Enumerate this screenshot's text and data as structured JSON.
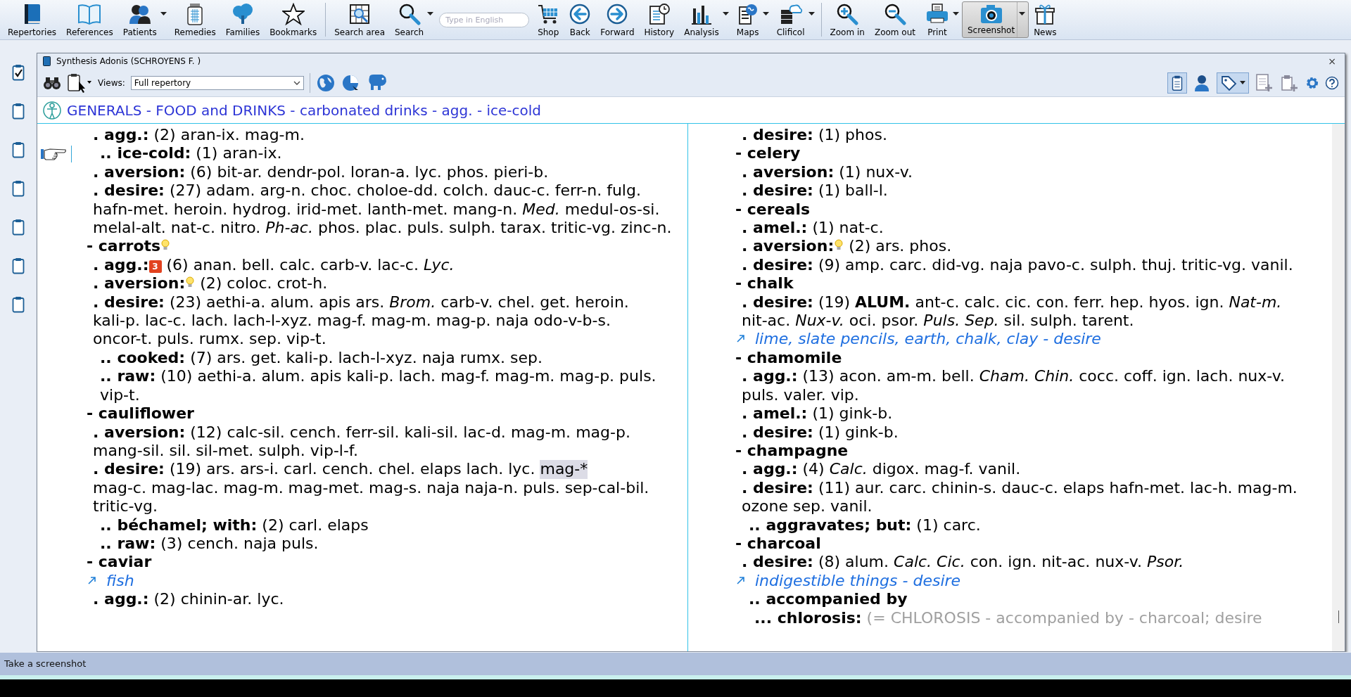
{
  "toolbar": {
    "groups": [
      [
        {
          "label": "Repertories",
          "dropdown": false,
          "selected": false
        },
        {
          "label": "References",
          "dropdown": false,
          "selected": false
        },
        {
          "label": "Patients",
          "dropdown": true,
          "selected": false
        },
        {
          "label": "Remedies",
          "dropdown": false,
          "selected": false
        },
        {
          "label": "Families",
          "dropdown": false,
          "selected": false
        },
        {
          "label": "Bookmarks",
          "dropdown": false,
          "selected": false
        }
      ],
      [
        {
          "label": "Search area",
          "dropdown": false,
          "selected": false
        },
        {
          "label": "Search",
          "dropdown": true,
          "selected": false
        },
        {
          "kind": "field",
          "placeholder": "Type in English"
        },
        {
          "label": "Shop",
          "dropdown": false,
          "selected": false
        },
        {
          "label": "Back",
          "dropdown": false,
          "selected": false
        },
        {
          "label": "Forward",
          "dropdown": false,
          "selected": false
        },
        {
          "label": "History",
          "dropdown": false,
          "selected": false
        },
        {
          "label": "Analysis",
          "dropdown": true,
          "selected": false
        },
        {
          "label": "Maps",
          "dropdown": true,
          "selected": false
        },
        {
          "label": "Clificol",
          "dropdown": true,
          "selected": false
        }
      ],
      [
        {
          "label": "Zoom in",
          "dropdown": false,
          "selected": false
        },
        {
          "label": "Zoom out",
          "dropdown": false,
          "selected": false
        },
        {
          "label": "Print",
          "dropdown": true,
          "selected": false
        },
        {
          "label": "Screenshot",
          "dropdown": true,
          "selected": true
        },
        {
          "label": "News",
          "dropdown": false,
          "selected": false
        }
      ]
    ]
  },
  "clipboards": [
    {
      "checked": true
    },
    {
      "checked": false
    },
    {
      "checked": false
    },
    {
      "checked": false
    },
    {
      "checked": false
    },
    {
      "checked": false
    },
    {
      "checked": false
    }
  ],
  "window": {
    "title": "Synthesis Adonis (SCHROYENS F. )",
    "close": "×",
    "views_label": "Views:",
    "views_value": "Full repertory",
    "breadcrumb": "GENERALS - FOOD and DRINKS - carbonated drinks - agg. - ice-cold"
  },
  "columns": [
    {
      "lines": [
        {
          "kind": "sub",
          "label": ". agg.:",
          "count": "(2)",
          "remedies": "aran-ix. mag-m.",
          "current": false
        },
        {
          "kind": "subsub",
          "label": ".. ice-cold:",
          "count": "(1)",
          "remedies": "aran-ix.",
          "current": true
        },
        {
          "kind": "sub",
          "label": ". aversion:",
          "count": "(6)",
          "remedies": "bit-ar. dendr-pol. loran-a. lyc. phos. pieri-b.",
          "current": false
        },
        {
          "kind": "sub",
          "label": ". desire:",
          "count": "(27)",
          "remedies": "adam. arg-n. choc. choloe-dd. colch. dauc-c. ferr-n. fulg. hafn-met. heroin. hydrog. irid-met. lanth-met. mang-n. *Med.* medul-os-si. melal-alt. nat-c. nitro. *Ph-ac.* phos. plac. puls. sulph. tarax. tritic-vg. zinc-n.",
          "current": false
        },
        {
          "kind": "rubric",
          "label": "- carrots",
          "marker": {
            "kind": "bulb"
          },
          "current": false
        },
        {
          "kind": "sub",
          "label": ". agg.:",
          "marker": {
            "kind": "number",
            "text": "3"
          },
          "count": "(6)",
          "remedies": "anan. bell. calc. carb-v. lac-c. *Lyc.*",
          "current": false
        },
        {
          "kind": "sub",
          "label": ". aversion:",
          "marker": {
            "kind": "bulb"
          },
          "count": "(2)",
          "remedies": "coloc. crot-h.",
          "current": false
        },
        {
          "kind": "sub",
          "label": ". desire:",
          "count": "(23)",
          "remedies": "aethi-a. alum. apis ars. *Brom.* carb-v. chel. get. heroin. kali-p. lac-c. lach. lach-l-xyz. mag-f. mag-m. mag-p. naja odo-v-b-s. oncor-t. puls. rumx. sep. vip-t.",
          "current": false
        },
        {
          "kind": "subsub",
          "label": ".. cooked:",
          "count": "(7)",
          "remedies": "ars. get. kali-p. lach-l-xyz. naja rumx. sep.",
          "current": false
        },
        {
          "kind": "subsub",
          "label": ".. raw:",
          "count": "(10)",
          "remedies": "aethi-a. alum. apis kali-p. lach. mag-f. mag-m. mag-p. puls. vip-t.",
          "current": false
        },
        {
          "kind": "rubric",
          "label": "- cauliflower",
          "current": false
        },
        {
          "kind": "sub",
          "label": ". aversion:",
          "count": "(12)",
          "remedies": "calc-sil. cench. ferr-sil. kali-sil. lac-d. mag-m. mag-p. mang-sil. sil. sil-met. sulph. vip-l-f.",
          "current": false
        },
        {
          "kind": "sub",
          "label": ". desire:",
          "count": "(19)",
          "remedies": [
            {
              "text": "ars. ars-i. carl. cench. chel. elaps lach. lyc.",
              "marked": false
            },
            {
              "text": "mag-*",
              "marked": true
            },
            {
              "text": "mag-c. mag-lac. mag-m. mag-met. mag-s. naja naja-n. puls. sep-cal-bil. tritic-vg.",
              "marked": false
            }
          ],
          "current": false
        },
        {
          "kind": "subsub",
          "label": ".. béchamel; with:",
          "count": "(2)",
          "remedies": "carl. elaps",
          "current": false
        },
        {
          "kind": "subsub",
          "label": ".. raw:",
          "count": "(3)",
          "remedies": "cench. naja puls.",
          "current": false
        },
        {
          "kind": "rubric",
          "label": "- caviar",
          "current": false
        },
        {
          "kind": "ref",
          "label": "fish",
          "current": false
        },
        {
          "kind": "sub",
          "label": ". agg.:",
          "count": "(2)",
          "remedies": "chinin-ar. lyc.",
          "current": false
        }
      ]
    },
    {
      "lines": [
        {
          "kind": "sub",
          "label": ". desire:",
          "count": "(1)",
          "remedies": "phos.",
          "current": false
        },
        {
          "kind": "rubric",
          "label": "- celery",
          "current": false
        },
        {
          "kind": "sub",
          "label": ". aversion:",
          "count": "(1)",
          "remedies": "nux-v.",
          "current": false
        },
        {
          "kind": "sub",
          "label": ". desire:",
          "count": "(1)",
          "remedies": "ball-l.",
          "current": false
        },
        {
          "kind": "rubric",
          "label": "- cereals",
          "current": false
        },
        {
          "kind": "sub",
          "label": ". amel.:",
          "count": "(1)",
          "remedies": "nat-c.",
          "current": false
        },
        {
          "kind": "sub",
          "label": ". aversion:",
          "marker": {
            "kind": "bulb"
          },
          "count": "(2)",
          "remedies": "ars. phos.",
          "current": false
        },
        {
          "kind": "sub",
          "label": ". desire:",
          "count": "(9)",
          "remedies": "amp. carc. did-vg. naja pavo-c. sulph. thuj. tritic-vg. vanil.",
          "current": false
        },
        {
          "kind": "rubric",
          "label": "- chalk",
          "current": false
        },
        {
          "kind": "sub",
          "label": ". desire:",
          "count": "(19)",
          "remedies": "**ALUM.** ant-c. calc. cic. con. ferr. hep. hyos. ign. *Nat-m.* nit-ac. *Nux-v.* oci. psor. *Puls.* *Sep.* sil. sulph. tarent.",
          "current": false
        },
        {
          "kind": "ref",
          "label": "lime, slate pencils, earth, chalk, clay - desire",
          "current": false
        },
        {
          "kind": "rubric",
          "label": "- chamomile",
          "current": false
        },
        {
          "kind": "sub",
          "label": ". agg.:",
          "count": "(13)",
          "remedies": "acon. am-m. bell. *Cham.* *Chin.* cocc. coff. ign. lach. nux-v. puls. valer. vip.",
          "current": false
        },
        {
          "kind": "sub",
          "label": ". amel.:",
          "count": "(1)",
          "remedies": "gink-b.",
          "current": false
        },
        {
          "kind": "sub",
          "label": ". desire:",
          "count": "(1)",
          "remedies": "gink-b.",
          "current": false
        },
        {
          "kind": "rubric",
          "label": "- champagne",
          "current": false
        },
        {
          "kind": "sub",
          "label": ". agg.:",
          "count": "(4)",
          "remedies": "*Calc.* digox. mag-f. vanil.",
          "current": false
        },
        {
          "kind": "sub",
          "label": ". desire:",
          "count": "(11)",
          "remedies": "aur. carc. chinin-s. dauc-c. elaps hafn-met. lac-h. mag-m. ozone sep. vanil.",
          "current": false
        },
        {
          "kind": "subsub",
          "label": ".. aggravates; but:",
          "count": "(1)",
          "remedies": "carc.",
          "current": false
        },
        {
          "kind": "rubric",
          "label": "- charcoal",
          "current": false
        },
        {
          "kind": "sub",
          "label": ". desire:",
          "count": "(8)",
          "remedies": "alum. *Calc.* *Cic.* con. ign. nit-ac. nux-v. *Psor.*",
          "current": false
        },
        {
          "kind": "ref",
          "label": "indigestible things - desire",
          "current": false
        },
        {
          "kind": "subsub",
          "label": ".. accompanied by",
          "current": false
        },
        {
          "kind": "sub3",
          "label": "... chlorosis:",
          "note": "(= CHLOROSIS - accompanied by - charcoal; desire",
          "current": false
        }
      ]
    }
  ],
  "status_bar": "Take a screenshot"
}
